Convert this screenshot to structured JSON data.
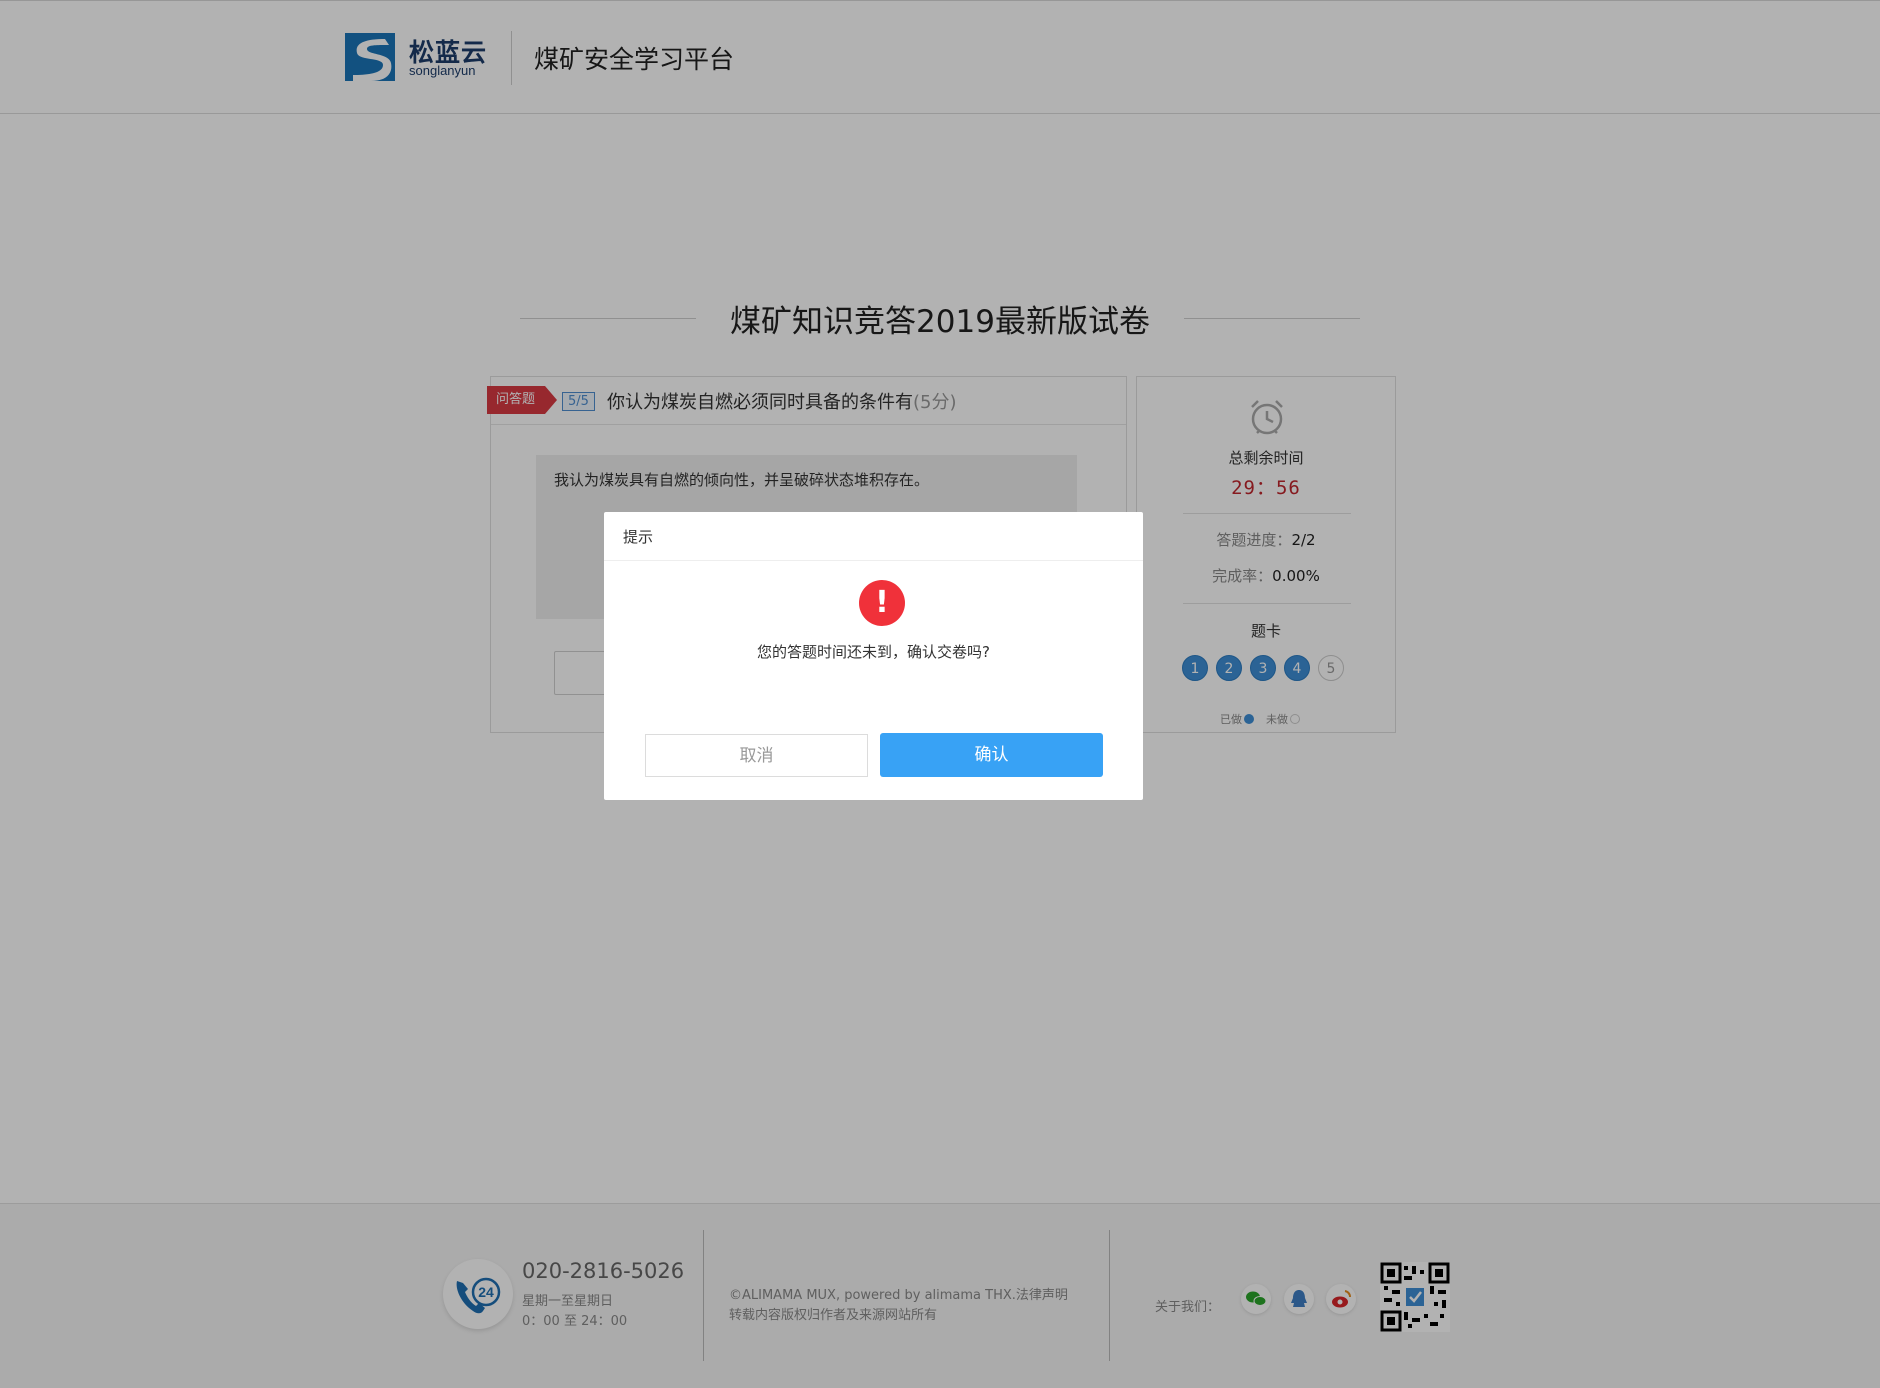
{
  "header": {
    "logo_cn": "松蓝云",
    "logo_en": "songlanyun",
    "platform_title": "煤矿安全学习平台"
  },
  "exam": {
    "title": "煤矿知识竞答2019最新版试卷"
  },
  "question": {
    "type_tag": "问答题",
    "number": "5/5",
    "text": "你认为煤炭自燃必须同时具备的条件有",
    "score": "(5分)",
    "answer": "我认为煤炭具有自燃的倾向性，并呈破碎状态堆积存在。"
  },
  "sidebar": {
    "remain_label": "总剩余时间",
    "remain_time": "29：56",
    "progress_key": "答题进度：",
    "progress_value": "2/2",
    "completion_key": "完成率：",
    "completion_value": "0.00%",
    "card_label": "题卡",
    "cards": [
      {
        "num": "1",
        "done": true
      },
      {
        "num": "2",
        "done": true
      },
      {
        "num": "3",
        "done": true
      },
      {
        "num": "4",
        "done": true
      },
      {
        "num": "5",
        "done": false
      }
    ],
    "legend_done": "已做",
    "legend_todo": "未做"
  },
  "footer": {
    "phone_badge": "24",
    "phone": "020-2816-5026",
    "hours_days": "星期一至星期日",
    "hours_time": "0：00 至 24：00",
    "copyright": "©ALIMAMA MUX, powered by alimama THX.法律声明",
    "reprint": "转载内容版权归作者及来源网站所有",
    "about_label": "关于我们："
  },
  "dialog": {
    "title": "提示",
    "message": "您的答题时间还未到，确认交卷吗?",
    "cancel_label": "取消",
    "confirm_label": "确认"
  },
  "colors": {
    "accent": "#38a2f5",
    "warning": "#f0313a",
    "timer": "#c0262d",
    "tag": "#d83a43",
    "card_done": "#3e8fd6"
  }
}
